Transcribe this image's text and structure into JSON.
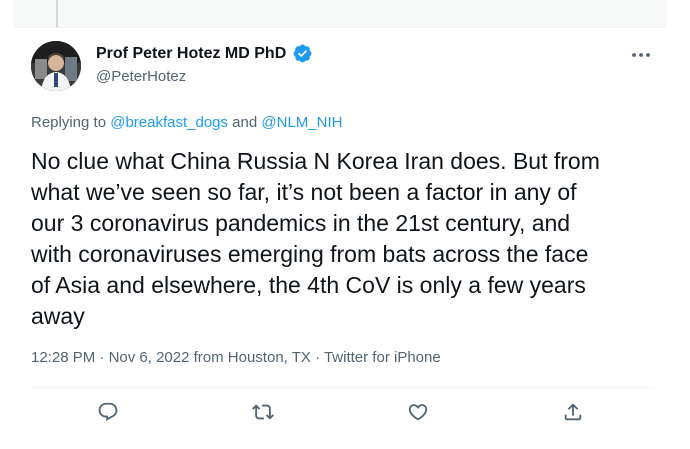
{
  "tweet": {
    "author": {
      "display_name": "Prof Peter Hotez MD PhD",
      "handle": "@PeterHotez",
      "verified": true
    },
    "replying_to": {
      "prefix": "Replying to ",
      "mention_1": "@breakfast_dogs",
      "conjunction": " and ",
      "mention_2": "@NLM_NIH"
    },
    "text_lines": [
      "No clue what China Russia N Korea Iran does. But from",
      "what we’ve seen so far, it’s not been a factor in any of",
      "our 3 coronavirus pandemics in the 21st century, and",
      "with coronaviruses emerging from bats across the face",
      "of Asia and elsewhere, the 4th CoV is only a few years",
      "away"
    ],
    "time": "12:28 PM",
    "date": "Nov 6, 2022",
    "location": "from Houston, TX",
    "source": "Twitter for iPhone",
    "separator": " · "
  },
  "actions": [
    {
      "name": "reply",
      "icon": "reply-icon"
    },
    {
      "name": "retweet",
      "icon": "retweet-icon"
    },
    {
      "name": "like",
      "icon": "heart-icon"
    },
    {
      "name": "share",
      "icon": "share-icon"
    }
  ],
  "colors": {
    "accent": "#1d9bf0",
    "text": "#0f1419",
    "secondary": "#536471",
    "divider": "#eff3f4"
  }
}
